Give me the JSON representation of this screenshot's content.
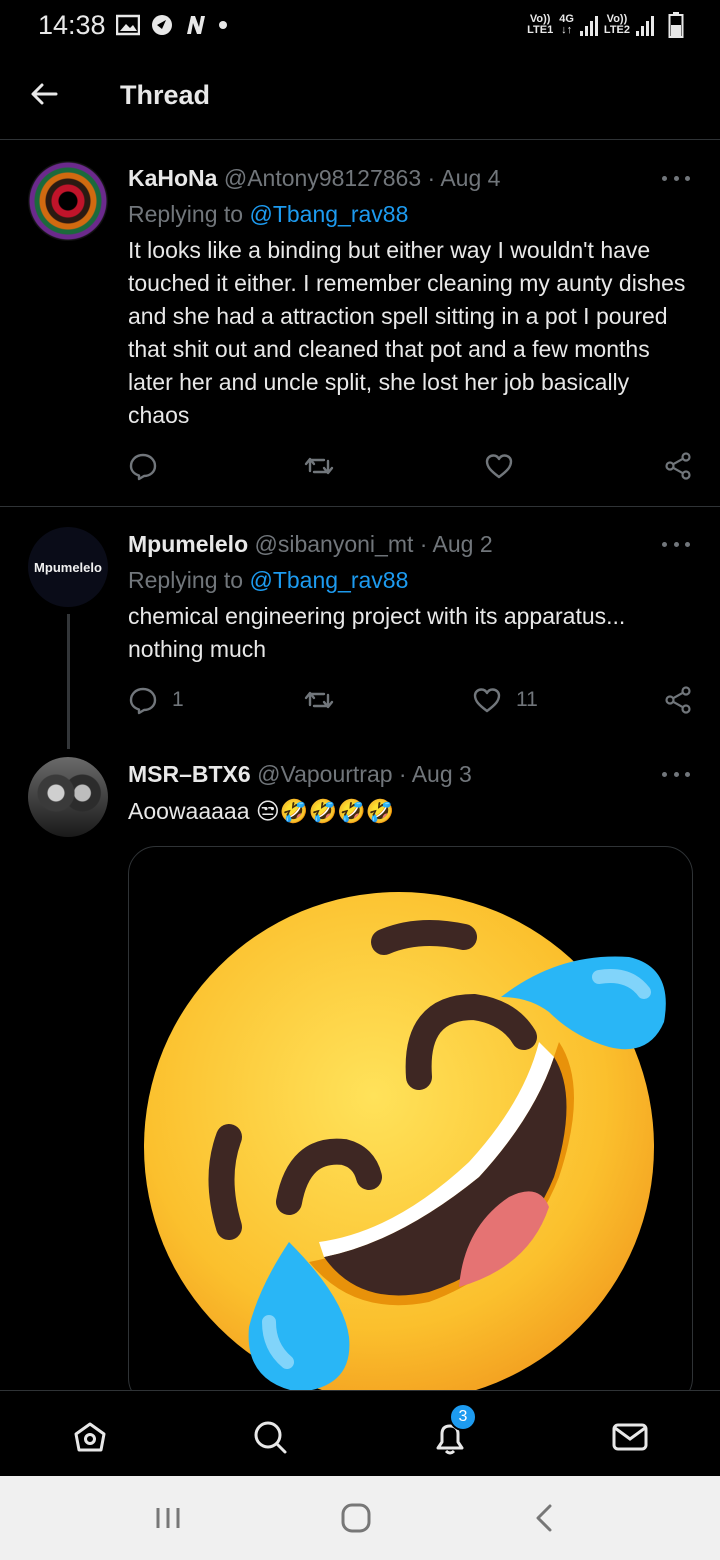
{
  "status_bar": {
    "time": "14:38",
    "sim1_label_top": "Vo))",
    "sim1_label_bottom": "LTE1",
    "net_label_top": "4G",
    "net_label_bottom": "↓↑",
    "sim2_label_top": "Vo))",
    "sim2_label_bottom": "LTE2"
  },
  "header": {
    "title": "Thread"
  },
  "tweets": [
    {
      "name": "KaHoNa",
      "meta": " @Antony98127863 · Aug 4",
      "replying_prefix": "Replying to ",
      "replying_handle": "@Tbang_rav88",
      "text": "It looks like a binding but either way I wouldn't have touched it either. I remember cleaning my aunty dishes and she had a attraction spell sitting in a pot I poured that shit out and cleaned that pot and a few months later her and uncle split, she lost her job basically chaos",
      "reply_count": "",
      "like_count": ""
    },
    {
      "name": "Mpumelelo",
      "meta": " @sibanyoni_mt · Aug 2",
      "avatar_text": "Mpumelelo",
      "replying_prefix": "Replying to ",
      "replying_handle": "@Tbang_rav88",
      "text": "chemical engineering project with its apparatus... nothing much",
      "reply_count": "1",
      "like_count": "11"
    },
    {
      "name": "MSR–BTX6",
      "meta": " @Vapourtrap · Aug 3",
      "text": "Aoowaaaaa 😒🤣🤣🤣🤣"
    }
  ],
  "bottom_nav": {
    "notification_badge": "3"
  },
  "colors": {
    "accent": "#1d9bf0",
    "muted": "#71767b",
    "divider": "#2f3336",
    "background": "#000000"
  }
}
